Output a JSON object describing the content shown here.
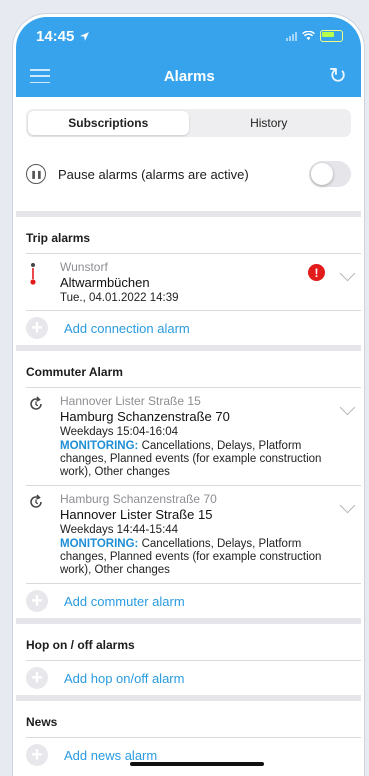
{
  "status_bar": {
    "time": "14:45"
  },
  "nav": {
    "title": "Alarms",
    "menu_icon": "hamburger-icon",
    "refresh_icon": "refresh-icon"
  },
  "tabs": [
    {
      "label": "Subscriptions",
      "active": true
    },
    {
      "label": "History",
      "active": false
    }
  ],
  "pause": {
    "label": "Pause alarms (alarms are active)",
    "enabled": false
  },
  "trip_alarms": {
    "title": "Trip alarms",
    "items": [
      {
        "from": "Wunstorf",
        "to": "Altwarmbüchen",
        "when": "Tue., 04.01.2022 14:39",
        "warning": "!"
      }
    ],
    "add_label": "Add connection alarm"
  },
  "commuter_alarms": {
    "title": "Commuter Alarm",
    "monitoring_label": "MONITORING:",
    "items": [
      {
        "from": "Hannover Lister Straße 15",
        "to": "Hamburg Schanzenstraße 70",
        "when": "Weekdays 15:04-16:04",
        "monitoring": " Cancellations, Delays, Platform changes, Planned events (for example construction work), Other changes"
      },
      {
        "from": "Hamburg Schanzenstraße 70",
        "to": "Hannover Lister Straße 15",
        "when": "Weekdays 14:44-15:44",
        "monitoring": " Cancellations, Delays, Platform changes, Planned events (for example construction work), Other changes"
      }
    ],
    "add_label": "Add commuter alarm"
  },
  "hop_alarms": {
    "title": "Hop on / off alarms",
    "add_label": "Add hop on/off alarm"
  },
  "news": {
    "title": "News",
    "add_label": "Add news alarm"
  },
  "colors": {
    "brand": "#36a3ec",
    "link": "#2a9be0",
    "warning": "#e21b1b"
  }
}
